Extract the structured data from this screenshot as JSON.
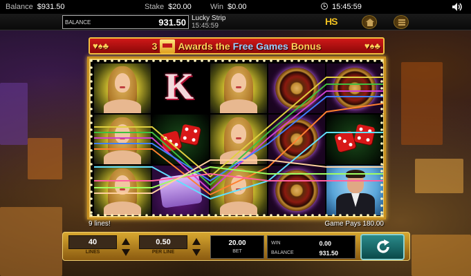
{
  "status_bar": {
    "balance_label": "Balance",
    "balance_value": "$931.50",
    "stake_label": "Stake",
    "stake_value": "$20.00",
    "win_label": "Win",
    "win_value": "$0.00",
    "time": "15:45:59",
    "icons": [
      "clock-icon",
      "speaker-icon"
    ]
  },
  "game_header": {
    "balance_label": "BALANCE",
    "balance_value": "931.50",
    "game_name": "Lucky Strip",
    "game_time": "15:45:59",
    "brand_logo_text": "HS",
    "icons": [
      "home-icon",
      "menu-icon"
    ]
  },
  "banner": {
    "count": "3",
    "text_before": "Awards the",
    "highlight": "Free Games",
    "text_after": "Bonus"
  },
  "reels": {
    "symbols": [
      [
        "woman",
        "woman",
        "woman"
      ],
      [
        "king",
        "dice",
        "logo"
      ],
      [
        "woman",
        "woman",
        "woman"
      ],
      [
        "roulette",
        "roulette",
        "roulette"
      ],
      [
        "roulette",
        "dice",
        "man"
      ]
    ]
  },
  "win_info": {
    "lines_text": "9 lines!",
    "game_pays_text": "Game Pays 180.00"
  },
  "controls": {
    "lines_value": "40",
    "lines_label": "LINES",
    "per_line_value": "0.50",
    "per_line_label": "PER LINE",
    "bet_value": "20.00",
    "bet_label": "BET",
    "win_label": "WIN",
    "win_value": "0.00",
    "balance_label": "BALANCE",
    "balance_value": "931.50",
    "spin_icon": "spin-icon"
  },
  "colors": {
    "banner_red": "#d01818",
    "frame_gold": "#c89020",
    "panel_gold": "#d8a830",
    "spin_teal": "#2a8a8a"
  }
}
